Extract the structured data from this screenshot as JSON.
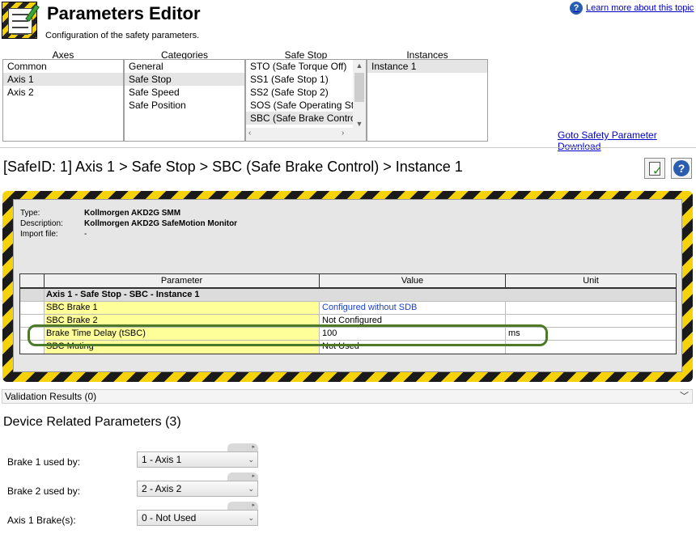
{
  "header": {
    "title": "Parameters Editor",
    "subtitle": "Configuration of the safety parameters.",
    "help_link": "Learn more about this topic",
    "help_icon_glyph": "?"
  },
  "selectors": {
    "axes": {
      "heading": "Axes",
      "items": [
        "Common",
        "Axis 1",
        "Axis 2"
      ],
      "selected": "Axis 1"
    },
    "categories": {
      "heading": "Categories",
      "items": [
        "General",
        "Safe Stop",
        "Safe Speed",
        "Safe Position"
      ],
      "selected": "Safe Stop"
    },
    "safe_stop": {
      "heading": "Safe Stop",
      "items": [
        "STO (Safe Torque Off)",
        "SS1 (Safe Stop 1)",
        "SS2 (Safe Stop 2)",
        "SOS (Safe Operating Sto",
        "SBC (Safe Brake Control)"
      ],
      "selected": "SBC (Safe Brake Control)"
    },
    "instances": {
      "heading": "Instances",
      "items": [
        "Instance 1"
      ],
      "selected": "Instance 1"
    }
  },
  "goto_link": "Goto Safety Parameter Download",
  "breadcrumb": "[SafeID: 1]  Axis 1 > Safe Stop > SBC (Safe Brake Control) > Instance 1",
  "device_info": {
    "type_label": "Type:",
    "type_value": "Kollmorgen AKD2G SMM",
    "description_label": "Description:",
    "description_value": "Kollmorgen AKD2G SafeMotion Monitor",
    "import_label": "Import file:",
    "import_value": "-"
  },
  "table": {
    "columns": [
      "Parameter",
      "Value",
      "Unit"
    ],
    "group": "Axis 1 - Safe Stop - SBC - Instance 1",
    "rows": [
      {
        "parameter": "SBC Brake 1",
        "value": "Configured without SDB",
        "unit": ""
      },
      {
        "parameter": "SBC Brake 2",
        "value": "Not Configured",
        "unit": ""
      },
      {
        "parameter": "Brake Time Delay (tSBC)",
        "value": "100",
        "unit": "ms"
      },
      {
        "parameter": "SBC Muting",
        "value": "Not Used",
        "unit": ""
      }
    ]
  },
  "validation": "Validation Results (0)",
  "device_params": {
    "title": "Device Related Parameters (3)",
    "items": [
      {
        "label": "Brake 1 used by:",
        "value": "1 - Axis 1"
      },
      {
        "label": "Brake 2 used by:",
        "value": "2 - Axis 2"
      },
      {
        "label": "Axis 1 Brake(s):",
        "value": "0 - Not Used"
      }
    ]
  },
  "colors": {
    "hazard_yellow": "#f5d20a",
    "hazard_black": "#1a1a1a",
    "row_highlight_yellow": "#ffff99",
    "link_blue": "#0000cc",
    "focus_outline_green": "#4c7a28"
  }
}
